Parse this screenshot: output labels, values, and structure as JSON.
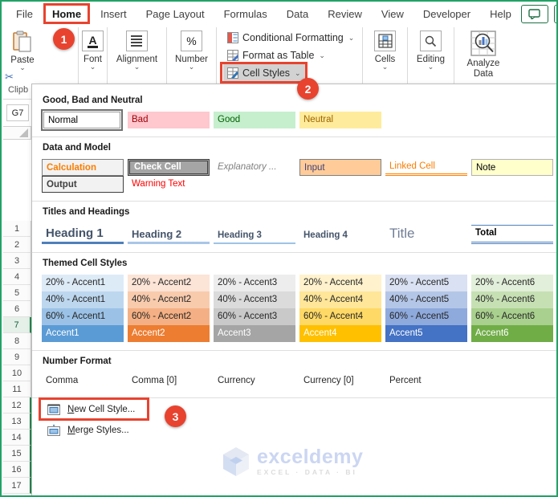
{
  "menubar": {
    "tabs": [
      {
        "label": "File"
      },
      {
        "label": "Home",
        "active": true
      },
      {
        "label": "Insert"
      },
      {
        "label": "Page Layout"
      },
      {
        "label": "Formulas"
      },
      {
        "label": "Data"
      },
      {
        "label": "Review"
      },
      {
        "label": "View"
      },
      {
        "label": "Developer"
      },
      {
        "label": "Help"
      }
    ]
  },
  "ribbon": {
    "paste_label": "Paste",
    "font_label": "Font",
    "font_icon_glyph": "A",
    "alignment_label": "Alignment",
    "number_label": "Number",
    "number_icon_glyph": "%",
    "cut_icon_glyph": "✂",
    "conditional_formatting_label": "Conditional Formatting",
    "format_as_table_label": "Format as Table",
    "cell_styles_label": "Cell Styles",
    "cells_label": "Cells",
    "editing_label": "Editing",
    "analyze_data_label": "Analyze Data"
  },
  "sheet": {
    "name_box_value": "G7",
    "clipboard_group_label": "Clipb",
    "row_numbers": [
      1,
      2,
      3,
      4,
      5,
      6,
      7,
      8,
      9,
      10,
      11,
      12,
      13,
      14,
      15,
      16,
      17
    ],
    "active_row": 7,
    "green_edge_from_row": 12
  },
  "gallery": {
    "sections": [
      {
        "title": "Good, Bad and Neutral",
        "rows": [
          [
            {
              "label": "Normal",
              "k": "sel"
            },
            {
              "label": "Bad",
              "bg": "#FFC7CE",
              "fg": "#9C0006"
            },
            {
              "label": "Good",
              "bg": "#C6EFCE",
              "fg": "#006100"
            },
            {
              "label": "Neutral",
              "bg": "#FFEB9C",
              "fg": "#9C6500"
            }
          ]
        ]
      },
      {
        "title": "Data and Model",
        "rows": [
          [
            {
              "label": "Calculation",
              "bg": "#F2F2F2",
              "fg": "#FA7D00",
              "bd": "#7F7F7F",
              "bold": true
            },
            {
              "label": "Check Cell",
              "k": "check",
              "bg": "#A5A5A5",
              "fg": "#FFFFFF",
              "bold": true
            },
            {
              "label": "Explanatory ...",
              "k": "ital",
              "fg": "#7F7F7F"
            },
            {
              "label": "Input",
              "bg": "#FFCC99",
              "fg": "#3F3F76",
              "bd": "#7F7F7F"
            },
            {
              "label": "Linked Cell",
              "k": "linked",
              "fg": "#FA7D00"
            },
            {
              "label": "Note",
              "bg": "#FFFFCC",
              "fg": "#000000",
              "bd": "#B2B2B2"
            }
          ],
          [
            {
              "label": "Output",
              "bg": "#F2F2F2",
              "fg": "#3F3F3F",
              "bd": "#3F3F3F",
              "bold": true
            },
            {
              "label": "Warning Text",
              "fg": "#FF0000"
            }
          ]
        ]
      },
      {
        "title": "Titles and Headings",
        "rows": [
          [
            {
              "label": "Heading 1",
              "k": "h1"
            },
            {
              "label": "Heading 2",
              "k": "h2"
            },
            {
              "label": "Heading 3",
              "k": "h3"
            },
            {
              "label": "Heading 4",
              "k": "h4"
            },
            {
              "label": "Title",
              "k": "title"
            },
            {
              "label": "Total",
              "k": "total"
            }
          ]
        ]
      },
      {
        "title": "Themed Cell Styles",
        "rows": [
          [
            {
              "label": "20% - Accent1",
              "bg": "#DDEBF7"
            },
            {
              "label": "20% - Accent2",
              "bg": "#FCE4D6"
            },
            {
              "label": "20% - Accent3",
              "bg": "#EDEDED"
            },
            {
              "label": "20% - Accent4",
              "bg": "#FFF2CC"
            },
            {
              "label": "20% - Accent5",
              "bg": "#D9E1F2"
            },
            {
              "label": "20% - Accent6",
              "bg": "#E2EFDA"
            }
          ],
          [
            {
              "label": "40% - Accent1",
              "bg": "#BDD7EE"
            },
            {
              "label": "40% - Accent2",
              "bg": "#F8CBAD"
            },
            {
              "label": "40% - Accent3",
              "bg": "#DBDBDB"
            },
            {
              "label": "40% - Accent4",
              "bg": "#FFE699"
            },
            {
              "label": "40% - Accent5",
              "bg": "#B4C6E7"
            },
            {
              "label": "40% - Accent6",
              "bg": "#C6E0B4"
            }
          ],
          [
            {
              "label": "60% - Accent1",
              "bg": "#9BC2E6"
            },
            {
              "label": "60% - Accent2",
              "bg": "#F4B084"
            },
            {
              "label": "60% - Accent3",
              "bg": "#C9C9C9"
            },
            {
              "label": "60% - Accent4",
              "bg": "#FFD966"
            },
            {
              "label": "60% - Accent5",
              "bg": "#8EA9DB"
            },
            {
              "label": "60% - Accent6",
              "bg": "#A9D08E"
            }
          ],
          [
            {
              "label": "Accent1",
              "bg": "#5B9BD5",
              "fg": "#FFFFFF"
            },
            {
              "label": "Accent2",
              "bg": "#ED7D31",
              "fg": "#FFFFFF"
            },
            {
              "label": "Accent3",
              "bg": "#A5A5A5",
              "fg": "#FFFFFF"
            },
            {
              "label": "Accent4",
              "bg": "#FFC000",
              "fg": "#FFFFFF"
            },
            {
              "label": "Accent5",
              "bg": "#4472C4",
              "fg": "#FFFFFF"
            },
            {
              "label": "Accent6",
              "bg": "#70AD47",
              "fg": "#FFFFFF"
            }
          ]
        ]
      },
      {
        "title": "Number Format",
        "rows": [
          [
            {
              "label": "Comma"
            },
            {
              "label": "Comma [0]"
            },
            {
              "label": "Currency"
            },
            {
              "label": "Currency [0]"
            },
            {
              "label": "Percent"
            }
          ]
        ]
      }
    ],
    "menu_items": [
      {
        "label": "New Cell Style...",
        "accelerator": "N",
        "highlighted": true
      },
      {
        "label": "Merge Styles...",
        "accelerator": "M"
      }
    ]
  },
  "annotations": {
    "steps": [
      "1",
      "2",
      "3"
    ],
    "color": "#E8432F"
  },
  "watermark": {
    "brand": "exceldemy",
    "tagline": "EXCEL · DATA · BI"
  }
}
